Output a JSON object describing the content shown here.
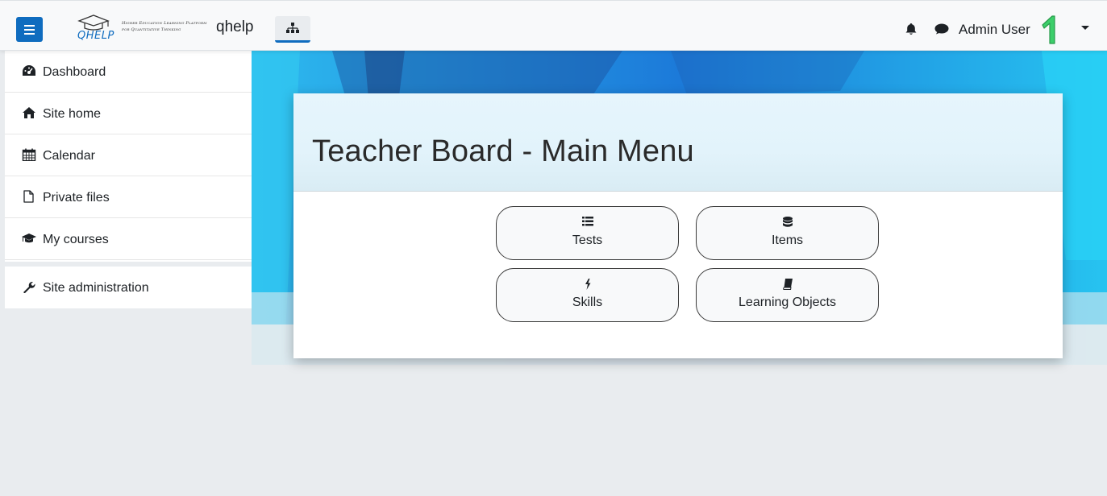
{
  "navbar": {
    "logo_word": "QHELP",
    "logo_tagline_1": "Higher Education Learning Platform",
    "logo_tagline_2": "for Quantitative Thinking",
    "brand": "qhelp",
    "user_name": "Admin User",
    "icons": [
      "menu-icon",
      "sitemap-icon",
      "bell-icon",
      "chat-icon",
      "avatar",
      "caret-down-icon"
    ]
  },
  "sidebar": {
    "items": [
      {
        "label": "Dashboard",
        "icon": "dashboard-icon"
      },
      {
        "label": "Site home",
        "icon": "home-icon"
      },
      {
        "label": "Calendar",
        "icon": "calendar-icon"
      },
      {
        "label": "Private files",
        "icon": "file-icon"
      },
      {
        "label": "My courses",
        "icon": "graduation-cap-icon"
      },
      {
        "label": "Site administration",
        "icon": "wrench-icon"
      }
    ]
  },
  "main": {
    "title": "Teacher Board - Main Menu",
    "tiles": [
      {
        "label": "Tests",
        "icon": "list-icon"
      },
      {
        "label": "Items",
        "icon": "database-icon"
      },
      {
        "label": "Skills",
        "icon": "bolt-icon"
      },
      {
        "label": "Learning Objects",
        "icon": "book-icon"
      }
    ]
  },
  "colors": {
    "accent": "#0f6cbf",
    "navbar_bg": "#f8f9fa",
    "page_bg": "#e9ecef",
    "avatar_green": "#3ccf6a"
  }
}
